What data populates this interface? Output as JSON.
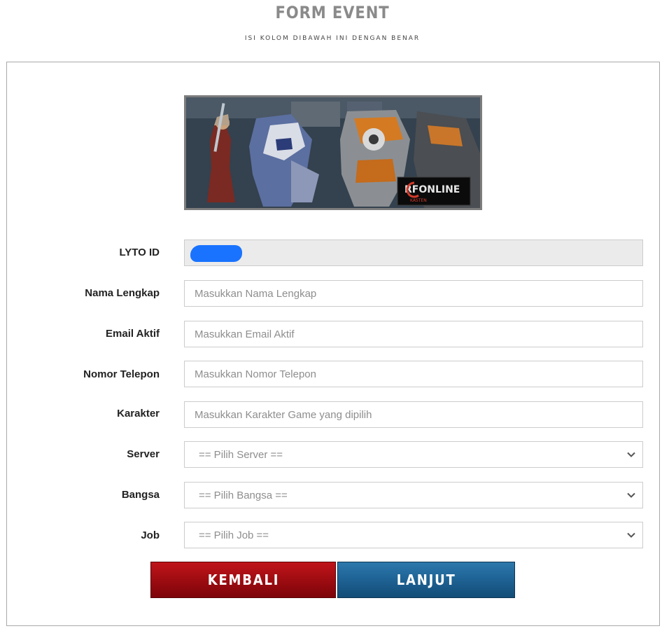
{
  "header": {
    "title": "FORM EVENT",
    "subtitle": "ISI KOLOM DIBAWAH INI DENGAN BENAR"
  },
  "banner": {
    "logo_text": "RFONLINE",
    "logo_subtext": "KASTEN"
  },
  "fields": {
    "lyto_id": {
      "label": "LYTO ID",
      "value": ""
    },
    "nama_lengkap": {
      "label": "Nama Lengkap",
      "placeholder": "Masukkan Nama Lengkap"
    },
    "email_aktif": {
      "label": "Email Aktif",
      "placeholder": "Masukkan Email Aktif"
    },
    "nomor_telepon": {
      "label": "Nomor Telepon",
      "placeholder": "Masukkan Nomor Telepon"
    },
    "karakter": {
      "label": "Karakter",
      "placeholder": "Masukkan Karakter Game yang dipilih"
    },
    "server": {
      "label": "Server",
      "selected": "== Pilih Server =="
    },
    "bangsa": {
      "label": "Bangsa",
      "selected": "== Pilih Bangsa =="
    },
    "job": {
      "label": "Job",
      "selected": "== Pilih Job =="
    }
  },
  "buttons": {
    "back_label": "KEMBALI",
    "next_label": "LANJUT"
  },
  "colors": {
    "back_button": "#a10d12",
    "next_button": "#1f6496",
    "redaction": "#1a73ff"
  }
}
